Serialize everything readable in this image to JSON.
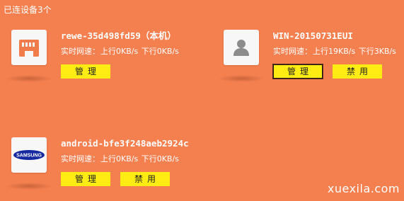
{
  "header": {
    "title": "已连设备3个"
  },
  "devices": [
    {
      "name": "rewe-35d498fd59（本机）",
      "speed_label": "实时网速：",
      "up": "上行0KB/s",
      "down": "下行0KB/s",
      "icon": "ethernet-port-icon",
      "buttons": [
        "管理"
      ]
    },
    {
      "name": "WIN-20150731EUI",
      "speed_label": "实时网速：",
      "up": "上行19KB/s",
      "down": "下行3KB/s",
      "icon": "user-avatar-icon",
      "buttons": [
        "管理",
        "禁用"
      ]
    },
    {
      "name": "android-bfe3f248aeb2924c",
      "speed_label": "实时网速：",
      "up": "上行0KB/s",
      "down": "下行0KB/s",
      "icon": "samsung-logo-icon",
      "logo_text": "SAMSUNG",
      "buttons": [
        "管理",
        "禁用"
      ]
    }
  ],
  "watermark": "xuexila.com",
  "colors": {
    "background": "#f47f4f",
    "button": "#ffec13",
    "ethernet_icon": "#f07c4c",
    "samsung_blue": "#1428a0"
  }
}
